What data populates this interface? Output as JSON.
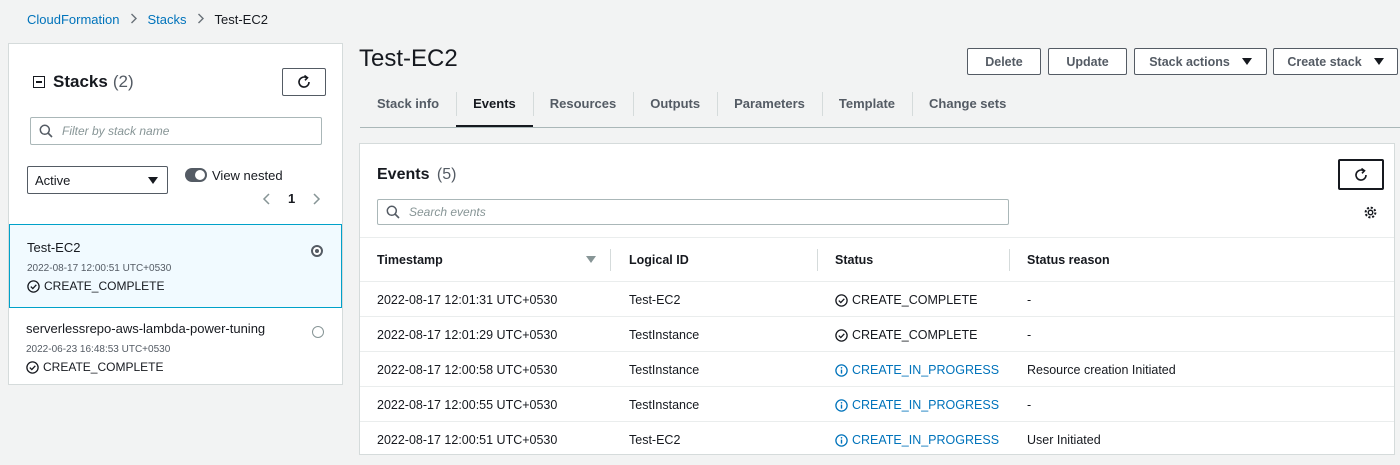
{
  "breadcrumb": {
    "items": [
      "CloudFormation",
      "Stacks"
    ],
    "current": "Test-EC2"
  },
  "left_panel": {
    "title": "Stacks",
    "count": "(2)",
    "filter_placeholder": "Filter by stack name",
    "status_filter": "Active",
    "view_nested_label": "View nested",
    "page_number": "1",
    "stacks": [
      {
        "name": "Test-EC2",
        "timestamp": "2022-08-17 12:00:51 UTC+0530",
        "status": "CREATE_COMPLETE",
        "selected": true
      },
      {
        "name": "serverlessrepo-aws-lambda-power-tuning",
        "timestamp": "2022-06-23 16:48:53 UTC+0530",
        "status": "CREATE_COMPLETE",
        "selected": false
      }
    ]
  },
  "main": {
    "title": "Test-EC2",
    "actions": {
      "delete": "Delete",
      "update": "Update",
      "stack_actions": "Stack actions",
      "create_stack": "Create stack"
    },
    "tabs": [
      {
        "label": "Stack info"
      },
      {
        "label": "Events"
      },
      {
        "label": "Resources"
      },
      {
        "label": "Outputs"
      },
      {
        "label": "Parameters"
      },
      {
        "label": "Template"
      },
      {
        "label": "Change sets"
      }
    ],
    "active_tab": "Events"
  },
  "events": {
    "title": "Events",
    "count": "(5)",
    "search_placeholder": "Search events",
    "columns": {
      "timestamp": "Timestamp",
      "logical_id": "Logical ID",
      "status": "Status",
      "status_reason": "Status reason"
    },
    "rows": [
      {
        "timestamp": "2022-08-17 12:01:31 UTC+0530",
        "logical_id": "Test-EC2",
        "status": "CREATE_COMPLETE",
        "reason": "-"
      },
      {
        "timestamp": "2022-08-17 12:01:29 UTC+0530",
        "logical_id": "TestInstance",
        "status": "CREATE_COMPLETE",
        "reason": "-"
      },
      {
        "timestamp": "2022-08-17 12:00:58 UTC+0530",
        "logical_id": "TestInstance",
        "status": "CREATE_IN_PROGRESS",
        "reason": "Resource creation Initiated"
      },
      {
        "timestamp": "2022-08-17 12:00:55 UTC+0530",
        "logical_id": "TestInstance",
        "status": "CREATE_IN_PROGRESS",
        "reason": "-"
      },
      {
        "timestamp": "2022-08-17 12:00:51 UTC+0530",
        "logical_id": "Test-EC2",
        "status": "CREATE_IN_PROGRESS",
        "reason": "User Initiated"
      }
    ]
  },
  "colors": {
    "link": "#0073bb",
    "complete": "#16191f",
    "in_progress": "#0073bb"
  }
}
